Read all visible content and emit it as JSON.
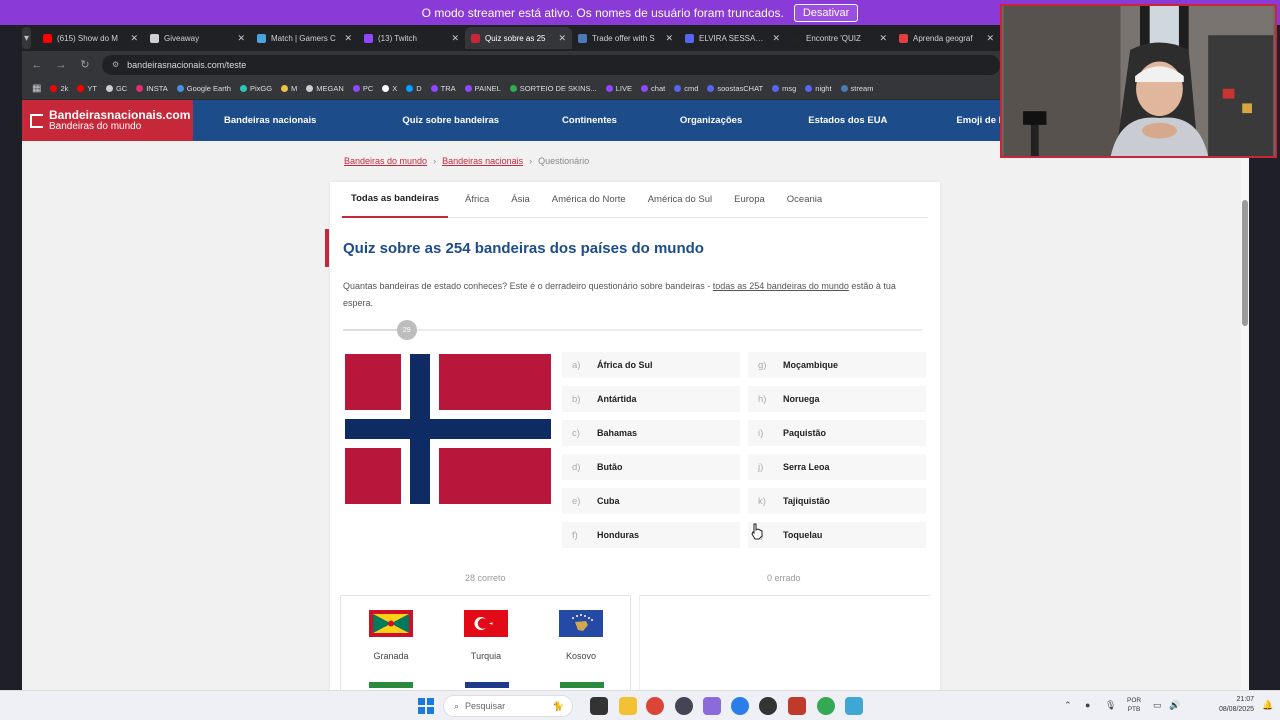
{
  "streamer": {
    "message": "O modo streamer está ativo. Os nomes de usuário foram truncados.",
    "button": "Desativar"
  },
  "tabs": [
    {
      "title": "(615) Show do M",
      "color": "#ff0000"
    },
    {
      "title": "Giveaway",
      "color": "#cfcfcf"
    },
    {
      "title": "Match | Gamers C",
      "color": "#4aa3df"
    },
    {
      "title": "(13) Twitch",
      "color": "#9146ff"
    },
    {
      "title": "Quiz sobre as 25",
      "color": "#c6283a",
      "active": true
    },
    {
      "title": "Trade offer with S",
      "color": "#4a7bb7"
    },
    {
      "title": "ELVIRA SESSAO D",
      "color": "#5865f2"
    },
    {
      "title": "Encontre 'QUIZ",
      "color": "#222222"
    },
    {
      "title": "Aprenda geograf",
      "color": "#e04040"
    }
  ],
  "address": {
    "url": "bandeirasnacionais.com/teste"
  },
  "bookmarks": [
    {
      "label": "2k",
      "color": "#ff0000"
    },
    {
      "label": "YT",
      "color": "#ff0000"
    },
    {
      "label": "GC",
      "color": "#cccccc"
    },
    {
      "label": "INSTA",
      "color": "#e1306c"
    },
    {
      "label": "Google Earth",
      "color": "#4a90e2"
    },
    {
      "label": "PixGG",
      "color": "#2ec4b6"
    },
    {
      "label": "M",
      "color": "#f0c040"
    },
    {
      "label": "MEGAN",
      "color": "#cccccc"
    },
    {
      "label": "PC",
      "color": "#9146ff"
    },
    {
      "label": "X",
      "color": "#ffffff"
    },
    {
      "label": "D",
      "color": "#00a2ff"
    },
    {
      "label": "TRA",
      "color": "#9146ff"
    },
    {
      "label": "PAINEL",
      "color": "#9146ff"
    },
    {
      "label": "SORTEIO DE SKINS...",
      "color": "#34a853"
    },
    {
      "label": "LIVE",
      "color": "#9146ff"
    },
    {
      "label": "chat",
      "color": "#9146ff"
    },
    {
      "label": "cmd",
      "color": "#5865f2"
    },
    {
      "label": "soostasCHAT",
      "color": "#5865f2"
    },
    {
      "label": "msg",
      "color": "#5865f2"
    },
    {
      "label": "night",
      "color": "#5865f2"
    },
    {
      "label": "stream",
      "color": "#4a7bb7"
    }
  ],
  "site": {
    "logo_main": "Bandeirasnacionais.com",
    "logo_sub": "Bandeiras do mundo",
    "nav": [
      "Bandeiras nacionais",
      "Quiz sobre bandeiras",
      "Continentes",
      "Organizações",
      "Estados dos EUA",
      "Emoji de bandeira"
    ],
    "breadcrumb": [
      "Bandeiras do mundo",
      "Bandeiras nacionais",
      "Questionário"
    ]
  },
  "quiz": {
    "tabs": [
      "Todas as bandeiras",
      "África",
      "Ásia",
      "América do Norte",
      "América do Sul",
      "Europa",
      "Oceania"
    ],
    "title": "Quiz sobre as 254 bandeiras dos países do mundo",
    "desc_before": "Quantas bandeiras de estado conheces? Este é o derradeiro questionário sobre bandeiras - ",
    "desc_link": "todas as 254 bandeiras do mundo",
    "desc_after": " estão à tua espera.",
    "progress_label": "29",
    "progress_fraction": 0.11,
    "options": [
      {
        "key": "a)",
        "label": "África do Sul"
      },
      {
        "key": "b)",
        "label": "Antártida"
      },
      {
        "key": "c)",
        "label": "Bahamas"
      },
      {
        "key": "d)",
        "label": "Butão"
      },
      {
        "key": "e)",
        "label": "Cuba"
      },
      {
        "key": "f)",
        "label": "Honduras"
      },
      {
        "key": "g)",
        "label": "Moçambique"
      },
      {
        "key": "h)",
        "label": "Noruega"
      },
      {
        "key": "i)",
        "label": "Paquistão"
      },
      {
        "key": "j)",
        "label": "Serra Leoa"
      },
      {
        "key": "k)",
        "label": "Tajiquistão"
      },
      {
        "key": "l)",
        "label": "Toquelau"
      }
    ],
    "correct_label": "28 correto",
    "wrong_label": "0 errado",
    "recent_correct": [
      "Granada",
      "Turquia",
      "Kosovo"
    ]
  },
  "taskbar": {
    "search": "Pesquisar",
    "lang_line1": "POR",
    "lang_line2": "PTB",
    "time": "21:07",
    "date": "08/08/2025"
  },
  "colors": {
    "brand_red": "#c6283a",
    "brand_blue": "#1d4c8a",
    "streamer_purple": "#8a3ad6"
  }
}
